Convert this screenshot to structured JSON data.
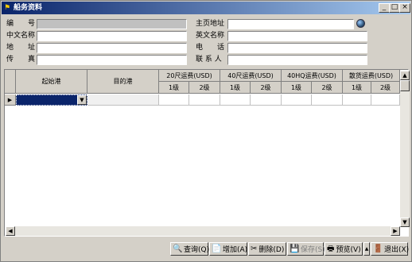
{
  "window": {
    "title": "船务资料"
  },
  "form": {
    "code_label": "编　　号",
    "homepage_label": "主页地址",
    "cn_name_label": "中文名称",
    "en_name_label": "英文名称",
    "address_label": "地　　址",
    "phone_label": "电　　话",
    "fax_label": "传　　真",
    "contact_label": "联 系 人"
  },
  "grid": {
    "headers": {
      "origin": "起始港",
      "dest": "目的港",
      "f20": "20尺运费(USD)",
      "f40": "40尺运费(USD)",
      "f40hq": "40HQ运费(USD)",
      "bulk": "散货运费(USD)",
      "lv1": "1级",
      "lv2": "2级"
    }
  },
  "buttons": {
    "query": "查询(Q)",
    "add": "增加(A)",
    "delete": "删除(D)",
    "save": "保存(S)",
    "preview": "预览(V)",
    "exit": "退出(X)"
  }
}
